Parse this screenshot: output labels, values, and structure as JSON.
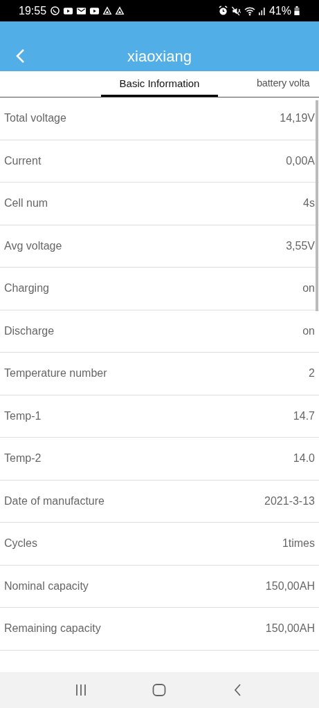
{
  "status_bar": {
    "time": "19:55",
    "battery": "41%"
  },
  "header": {
    "title": "xiaoxiang"
  },
  "tabs": [
    {
      "label": "Basic Information",
      "selected": true
    },
    {
      "label": "battery volta",
      "selected": false
    }
  ],
  "rows": [
    {
      "label": "Total voltage",
      "value": "14,19V"
    },
    {
      "label": "Current",
      "value": "0,00A"
    },
    {
      "label": "Cell num",
      "value": "4s"
    },
    {
      "label": "Avg voltage",
      "value": "3,55V"
    },
    {
      "label": "Charging",
      "value": "on"
    },
    {
      "label": "Discharge",
      "value": "on"
    },
    {
      "label": "Temperature number",
      "value": "2"
    },
    {
      "label": "Temp-1",
      "value": "14.7"
    },
    {
      "label": "Temp-2",
      "value": "14.0"
    },
    {
      "label": "Date of manufacture",
      "value": "2021-3-13"
    },
    {
      "label": "Cycles",
      "value": "1times"
    },
    {
      "label": "Nominal capacity",
      "value": "150,00AH"
    },
    {
      "label": "Remaining capacity",
      "value": "150,00AH"
    }
  ]
}
